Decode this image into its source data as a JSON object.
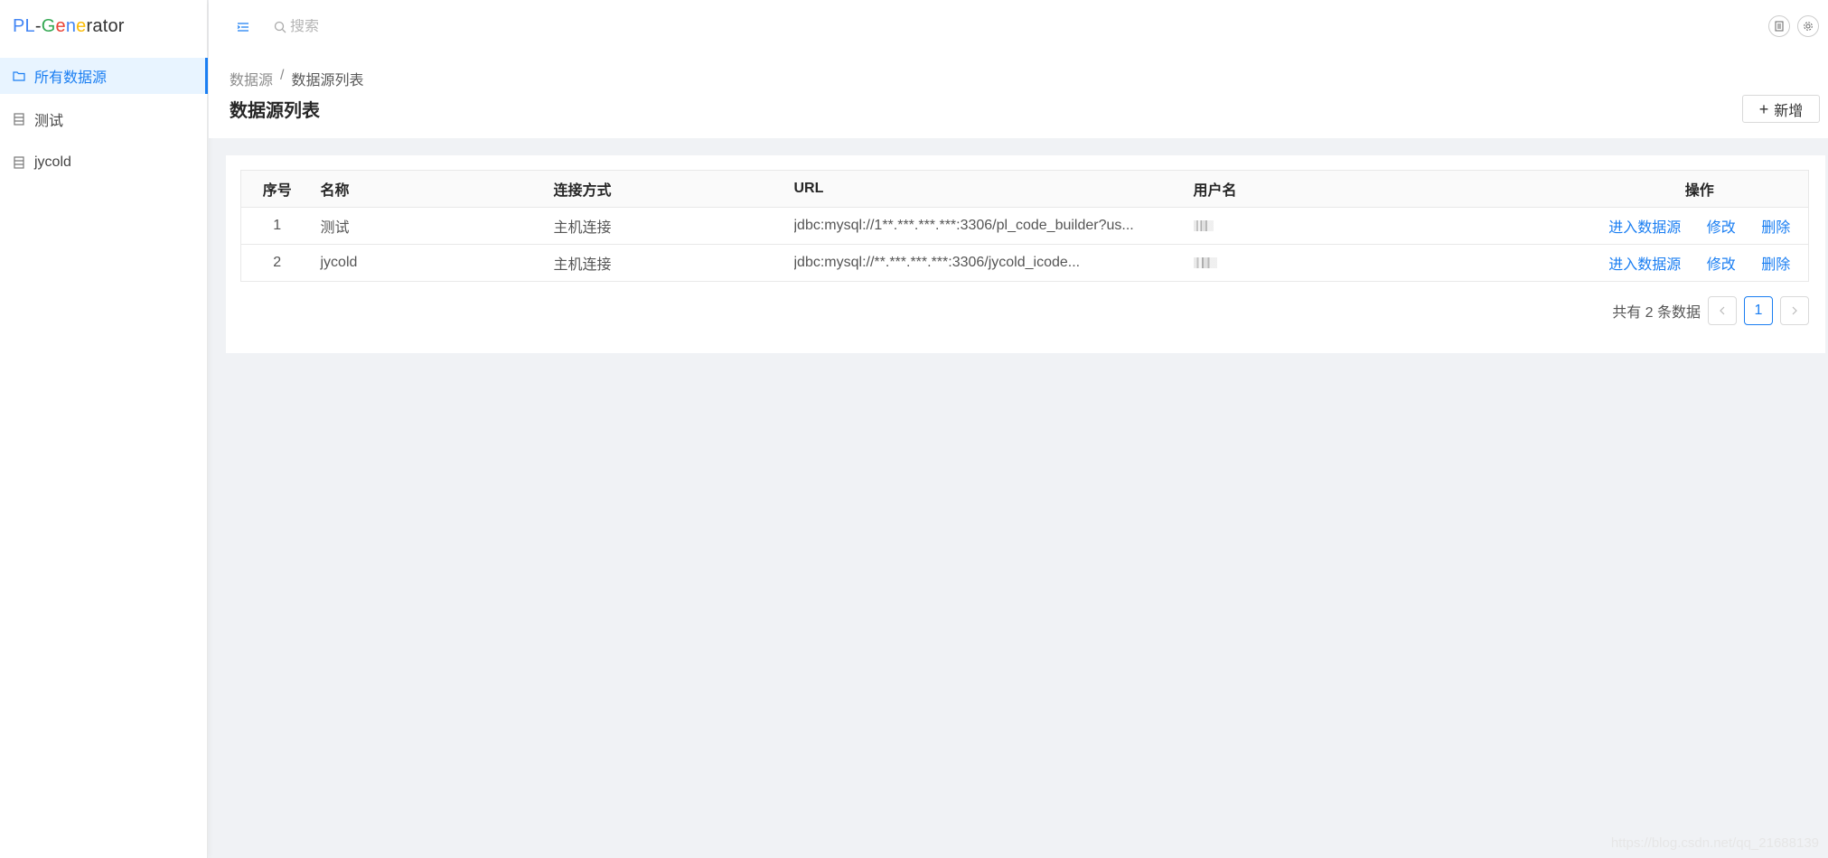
{
  "app": {
    "logo_letters": [
      {
        "ch": "P",
        "color": "#4285f4"
      },
      {
        "ch": "L",
        "color": "#4285f4"
      },
      {
        "ch": "-",
        "color": "#333333"
      },
      {
        "ch": "G",
        "color": "#34a853"
      },
      {
        "ch": "e",
        "color": "#ea4335"
      },
      {
        "ch": "n",
        "color": "#4285f4"
      },
      {
        "ch": "e",
        "color": "#fbbc05"
      },
      {
        "ch": "r",
        "color": "#333333"
      },
      {
        "ch": "a",
        "color": "#333333"
      },
      {
        "ch": "t",
        "color": "#333333"
      },
      {
        "ch": "o",
        "color": "#333333"
      },
      {
        "ch": "r",
        "color": "#333333"
      }
    ],
    "accent_color": "#1a7ef2"
  },
  "sidebar": {
    "items": [
      {
        "label": "所有数据源",
        "icon": "folder-icon",
        "active": true
      },
      {
        "label": "测试",
        "icon": "database-icon",
        "active": false
      },
      {
        "label": "jycold",
        "icon": "database-icon",
        "active": false
      }
    ]
  },
  "header": {
    "search_placeholder": "搜索"
  },
  "page": {
    "breadcrumb_root": "数据源",
    "breadcrumb_separator": "/",
    "breadcrumb_current": "数据源列表",
    "title": "数据源列表",
    "add_label": "新增"
  },
  "table": {
    "columns": [
      "序号",
      "名称",
      "连接方式",
      "URL",
      "用户名",
      "操作"
    ],
    "rows": [
      {
        "index": "1",
        "name": "测试",
        "connection": "主机连接",
        "url": "jdbc:mysql://1**.***.***.***:3306/pl_code_builder?us...",
        "username": "",
        "ops": [
          "进入数据源",
          "修改",
          "删除"
        ]
      },
      {
        "index": "2",
        "name": "jycold",
        "connection": "主机连接",
        "url": "jdbc:mysql://**.***.***.***:3306/jycold_icode...",
        "username": "",
        "ops": [
          "进入数据源",
          "修改",
          "删除"
        ]
      }
    ]
  },
  "pagination": {
    "total_text": "共有 2 条数据",
    "current_page": "1",
    "prev_icon": "chevron-left-icon",
    "next_icon": "chevron-right-icon"
  },
  "watermark": "https://blog.csdn.net/qq_21688139"
}
